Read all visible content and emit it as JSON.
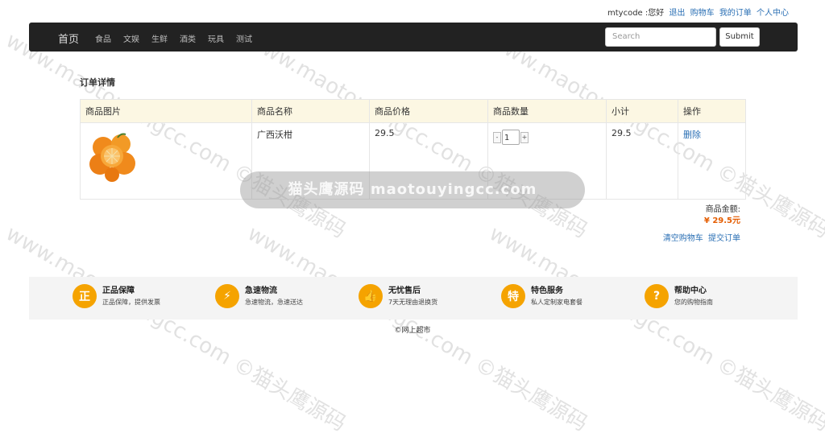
{
  "user_bar": {
    "greeting": "mtycode :您好",
    "logout": "退出",
    "cart": "购物车",
    "my_orders": "我的订单",
    "profile": "个人中心"
  },
  "navbar": {
    "brand": "首页",
    "links": [
      "食品",
      "文娱",
      "生鲜",
      "酒类",
      "玩具",
      "测试"
    ],
    "search_placeholder": "Search",
    "submit_label": "Submit"
  },
  "page_title": "订单详情",
  "table": {
    "headers": [
      "商品图片",
      "商品名称",
      "商品价格",
      "商品数量",
      "小计",
      "操作"
    ],
    "rows": [
      {
        "name": "广西沃柑",
        "price": "29.5",
        "quantity": "1",
        "minus": "-",
        "plus": "+",
        "subtotal": "29.5",
        "action": "删除"
      }
    ]
  },
  "summary": {
    "total_label": "商品金额:",
    "total_value": "¥ 29.5元",
    "clear_cart": "清空购物车",
    "submit_order": "提交订单"
  },
  "features": [
    {
      "icon_glyph": "正",
      "title": "正品保障",
      "sub": "正品保障，提供发票"
    },
    {
      "icon_glyph": "⚡",
      "title": "急速物流",
      "sub": "急速物流，急速送达"
    },
    {
      "icon_glyph": "👍",
      "title": "无忧售后",
      "sub": "7天无理由退换货"
    },
    {
      "icon_glyph": "特",
      "title": "特色服务",
      "sub": "私人定制家电套餐"
    },
    {
      "icon_glyph": "?",
      "title": "帮助中心",
      "sub": "您的购物指南"
    }
  ],
  "copyright": "©网上超市",
  "watermark": {
    "banner": "猫头鹰源码 maotouyingcc.com",
    "diagonal": "www.maotouyingcc.com ©猫头鹰源码"
  },
  "colors": {
    "navbar_bg": "#222222",
    "table_header_bg": "#fcf7e3",
    "accent_orange": "#f5a300",
    "price_red": "#e45c00",
    "link_blue": "#2a6fb4"
  }
}
